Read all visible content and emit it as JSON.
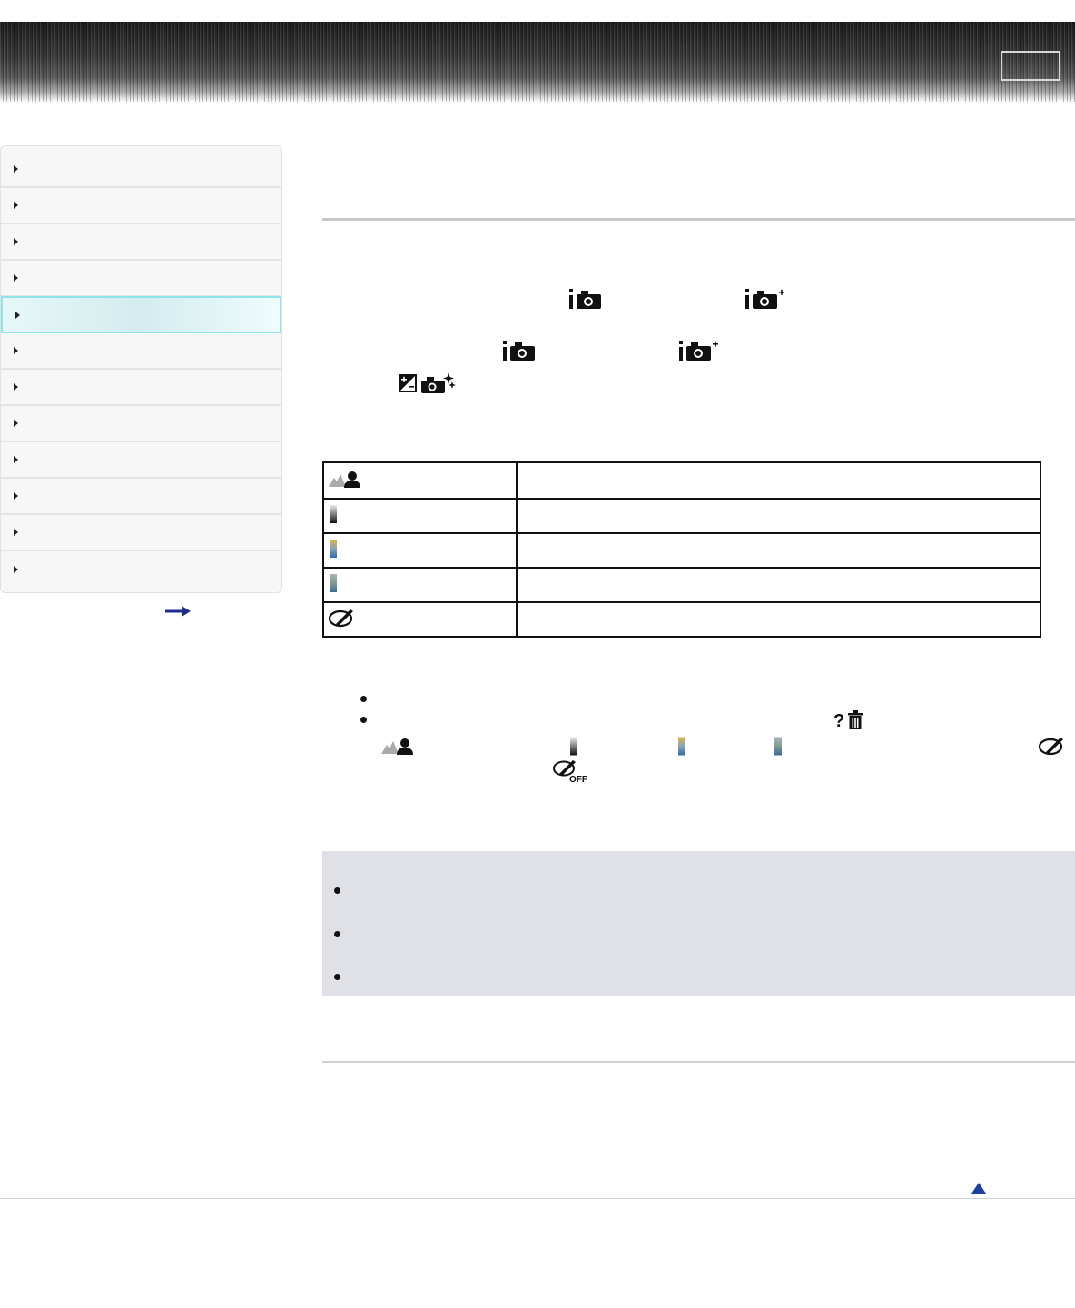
{
  "header": {
    "box_label": ""
  },
  "sidebar": {
    "items": [
      {
        "label": ""
      },
      {
        "label": ""
      },
      {
        "label": ""
      },
      {
        "label": ""
      },
      {
        "label": "",
        "active": true
      },
      {
        "label": ""
      },
      {
        "label": ""
      },
      {
        "label": ""
      },
      {
        "label": ""
      },
      {
        "label": ""
      },
      {
        "label": ""
      },
      {
        "label": ""
      }
    ]
  },
  "content": {
    "table_rows": [
      {
        "icon": "portrait-landscape-icon",
        "text": ""
      },
      {
        "icon": "monochrome-gradient-icon",
        "text": ""
      },
      {
        "icon": "warm-color-gradient-icon",
        "text": ""
      },
      {
        "icon": "cool-color-gradient-icon",
        "text": ""
      },
      {
        "icon": "photo-retouch-icon",
        "text": ""
      }
    ]
  },
  "colors": {
    "accent_active": "#8fe3ea",
    "note_bg": "#dfe1e6",
    "page_top_arrow": "#1f3f9e"
  }
}
